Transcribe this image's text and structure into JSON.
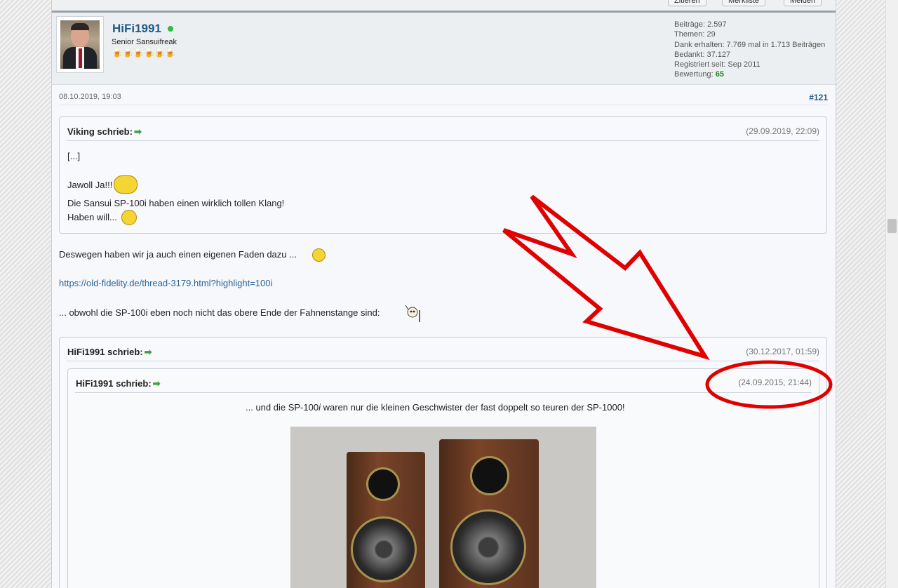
{
  "toolbar": {
    "btn1": "Zitieren",
    "btn2": "Merkliste",
    "btn3": "Melden"
  },
  "user": {
    "name": "HiFi1991",
    "title": "Senior Sansuifreak",
    "rank_icons": "🍺🍺🍺🍺🍺🍺",
    "stats": {
      "posts": "Beiträge: 2.597",
      "threads": "Themen: 29",
      "thanks_received": "Dank erhalten: 7.769 mal in 1.713 Beiträgen",
      "thanked": "Bedankt: 37.127",
      "registered": "Registriert seit: Sep 2011",
      "rating_label": "Bewertung:",
      "rating_value": "65"
    }
  },
  "post": {
    "date": "08.10.2019, 19:03",
    "number": "#121"
  },
  "quote1": {
    "author": "Viking schrieb:",
    "date": "(29.09.2019, 22:09)",
    "line1": "[...]",
    "line2": "Jawoll Ja!!!",
    "line3": "Die Sansui SP-100i haben einen wirklich tollen Klang!",
    "line4": "Haben will..."
  },
  "body": {
    "line1": "Deswegen haben wir ja auch einen eigenen Faden dazu ...",
    "link": "https://old-fidelity.de/thread-3179.html?highlight=100i",
    "line2": "... obwohl die SP-100i eben noch nicht das obere Ende der Fahnenstange sind:"
  },
  "quote2": {
    "author": "HiFi1991 schrieb:",
    "date": "(30.12.2017, 01:59)"
  },
  "quote3": {
    "author": "HiFi1991 schrieb:",
    "date": "(24.09.2015, 21:44)",
    "text_a": "... und die SP-100",
    "text_i": "i",
    "text_b": " waren nur die kleinen Geschwister der fast doppelt so teuren der SP-1000!"
  },
  "colors": {
    "annotation": "#e00000",
    "link": "#2a6496",
    "username": "#1f5a8a"
  }
}
